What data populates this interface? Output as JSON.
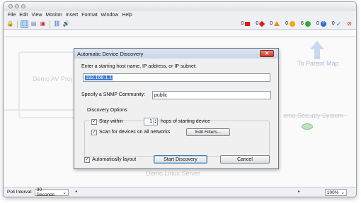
{
  "menu": [
    "File",
    "Edit",
    "View",
    "Monitor",
    "Insert",
    "Format",
    "Window",
    "Help"
  ],
  "status_counts": [
    {
      "count": "0",
      "color": "#e01818",
      "shape": "square",
      "icon": "red-square-icon"
    },
    {
      "count": "0",
      "color": "#e01818",
      "shape": "diamond",
      "icon": "red-diamond-icon"
    },
    {
      "count": "0",
      "color": "#f08a18",
      "shape": "triangle",
      "icon": "orange-triangle-icon"
    },
    {
      "count": "0",
      "color": "#f0a818",
      "shape": "circle",
      "icon": "yellow-circle-icon"
    },
    {
      "count": "6",
      "color": "#38a838",
      "shape": "circle",
      "icon": "green-circle-icon"
    },
    {
      "count": "0",
      "color": "#2a6cc8",
      "shape": "question",
      "icon": "blue-question-icon"
    },
    {
      "count": "0",
      "color": "#2a6cc8",
      "shape": "check",
      "icon": "check-icon"
    }
  ],
  "canvas": {
    "labels": {
      "demo_av": "Demo AV Proj",
      "to_parent": "To Parent Map",
      "demo_security": "emo Security System",
      "demo_linux": "Demo Linux Server"
    }
  },
  "dialog": {
    "title": "Automatic Device Discovery",
    "host_label": "Enter a starting host name, IP address, or IP subnet:",
    "host_value": "192.168.1.1",
    "snmp_label": "Specify a SNMP Community:",
    "snmp_value": "public",
    "options_title": "Discovery Options",
    "stay_within_label": "Stay within",
    "hops_value": "1",
    "hops_label": "hops of starting device",
    "scan_all_label": "Scan for devices on all networks",
    "edit_filters_label": "Edit Filters...",
    "auto_layout_label": "Automatically layout",
    "start_label": "Start Discovery",
    "cancel_label": "Cancel",
    "stay_within_checked": true,
    "scan_all_checked": true,
    "auto_layout_checked": true
  },
  "statusbar": {
    "poll_label": "Poll Interval:",
    "poll_value": "30 Seconds",
    "zoom_value": "100%"
  }
}
